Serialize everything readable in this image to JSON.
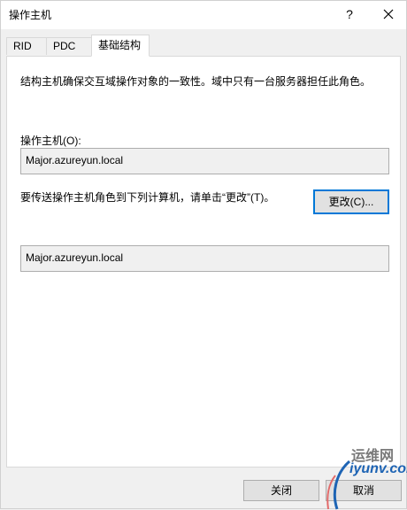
{
  "window": {
    "title": "操作主机",
    "help_label": "?",
    "close_icon": "close-icon"
  },
  "tabs": [
    {
      "label": "RID",
      "active": false
    },
    {
      "label": "PDC",
      "active": false
    },
    {
      "label": "基础结构",
      "active": true
    }
  ],
  "panel": {
    "description": "结构主机确保交互域操作对象的一致性。域中只有一台服务器担任此角色。",
    "owner_label": "操作主机(O):",
    "owner_value": "Major.azureyun.local",
    "transfer_text": "要传送操作主机角色到下列计算机，请单击“更改”(T)。",
    "change_button": "更改(C)...",
    "target_value": "Major.azureyun.local"
  },
  "footer": {
    "close_button": "关闭",
    "cancel_button": "取消"
  },
  "watermark": {
    "site_name": "运维网",
    "site_domain": "iyunv.com"
  }
}
